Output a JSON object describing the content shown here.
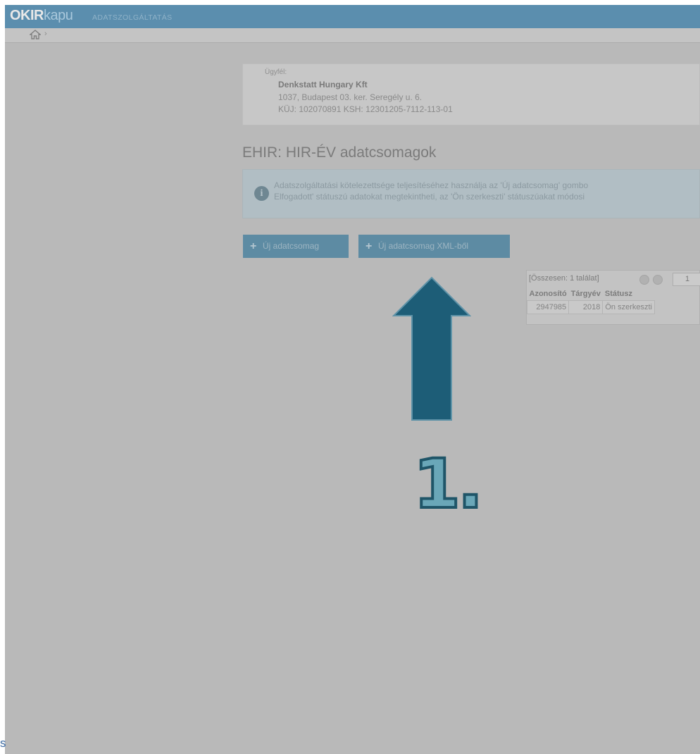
{
  "header": {
    "logo_strong": "OKIR",
    "logo_light": "kapu",
    "subtitle": "ADATSZOLGÁLTATÁS"
  },
  "breadcrumb": {
    "home_icon": "home-icon",
    "separator": "›"
  },
  "client": {
    "label": "Ügyfél:",
    "name": "Denkstatt Hungary Kft",
    "address": "1037, Budapest 03. ker. Seregély u. 6.",
    "ids": "KÜJ: 102070891  KSH: 12301205-7112-113-01"
  },
  "page_title": "EHIR: HIR-ÉV adatcsomagok",
  "info": {
    "icon": "info-icon",
    "line1": "Adatszolgáltatási kötelezettsége teljesítéséhez használja az 'Új adatcsomag' gombo",
    "line2": "Elfogadott' státuszú adatokat megtekintheti, az 'Ön szerkeszti' státuszúakat módosi"
  },
  "buttons": {
    "new_package": "Új adatcsomag",
    "new_package_xml": "Új adatcsomag XML-ből"
  },
  "results": {
    "count_text": "[Összesen: 1 találat]",
    "page": "1",
    "columns": [
      "Azonosító",
      "Tárgyév",
      "Státusz"
    ],
    "rows": [
      [
        "2947985",
        "2018",
        "Ön szerkeszti"
      ]
    ]
  },
  "annotation": {
    "arrow_color": "#1d5d77",
    "step_label": "1."
  },
  "edge_text": "s"
}
